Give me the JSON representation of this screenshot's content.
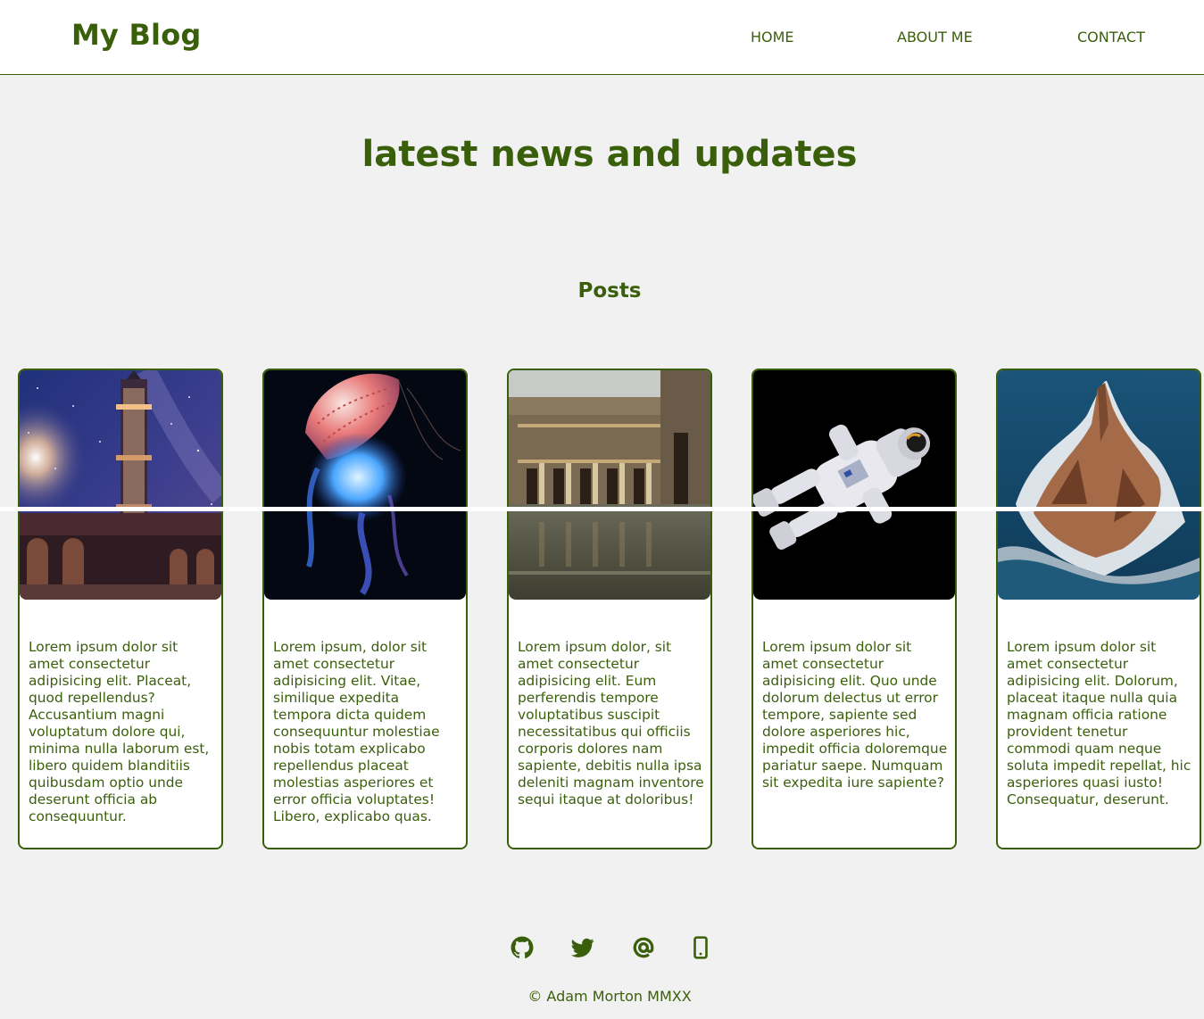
{
  "header": {
    "brand": "My Blog",
    "nav": [
      {
        "label": "HOME"
      },
      {
        "label": "ABOUT ME"
      },
      {
        "label": "CONTACT"
      }
    ]
  },
  "hero": {
    "title": "latest news and updates",
    "section_title": "Posts"
  },
  "posts": [
    {
      "image": "minaret-night-sky",
      "text": "Lorem ipsum dolor sit amet consectetur adipisicing elit. Placeat, quod repellendus? Accusantium magni voluptatum dolore qui, minima nulla laborum est, libero quidem blanditiis quibusdam optio unde deserunt officia ab consequuntur."
    },
    {
      "image": "jellyfish",
      "text": "Lorem ipsum, dolor sit amet consectetur adipisicing elit. Vitae, similique expedita tempora dicta quidem consequuntur molestiae nobis totam explicabo repellendus placeat molestias asperiores et error officia voluptates! Libero, explicabo quas."
    },
    {
      "image": "roman-baths",
      "text": "Lorem ipsum dolor, sit amet consectetur adipisicing elit. Eum perferendis tempore voluptatibus suscipit necessitatibus qui officiis corporis dolores nam sapiente, debitis nulla ipsa deleniti magnam inventore sequi itaque at doloribus!"
    },
    {
      "image": "astronaut",
      "text": "Lorem ipsum dolor sit amet consectetur adipisicing elit. Quo unde dolorum delectus ut error tempore, sapiente sed dolore asperiores hic, impedit officia doloremque pariatur saepe. Numquam sit expedita iure sapiente?"
    },
    {
      "image": "sea-rock",
      "text": "Lorem ipsum dolor sit amet consectetur adipisicing elit. Dolorum, placeat itaque nulla quia magnam officia ratione provident tenetur commodi quam neque soluta impedit repellat, hic asperiores quasi iusto! Consequatur, deserunt."
    }
  ],
  "footer": {
    "social_icons": [
      "github-icon",
      "twitter-icon",
      "at-sign-icon",
      "mobile-phone-icon"
    ],
    "copyright": "© Adam Morton MMXX"
  },
  "colors": {
    "accent": "#3a5f0b",
    "background": "#f1f1f1",
    "surface": "#ffffff"
  }
}
